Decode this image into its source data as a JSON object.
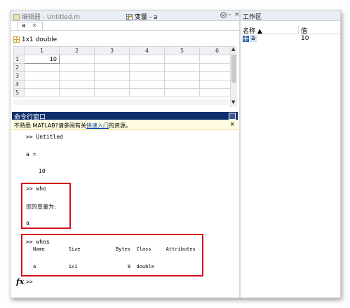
{
  "editor_tab": {
    "label": "编辑器 - Untitled.m"
  },
  "variable_tab": {
    "label": "变量 - a",
    "menu_icon": "options-icon",
    "minimize_icon": "minimize-icon",
    "close_icon": "close-icon"
  },
  "variable_subtab": {
    "label": "a",
    "close": "×"
  },
  "variable_info": {
    "label": "1x1 double"
  },
  "grid": {
    "columns": [
      "1",
      "2",
      "3",
      "4",
      "5",
      "6"
    ],
    "rows": [
      {
        "label": "1",
        "cells": [
          "10",
          "",
          "",
          "",
          "",
          ""
        ]
      },
      {
        "label": "2",
        "cells": [
          "",
          "",
          "",
          "",
          "",
          ""
        ]
      },
      {
        "label": "3",
        "cells": [
          "",
          "",
          "",
          "",
          "",
          ""
        ]
      },
      {
        "label": "4",
        "cells": [
          "",
          "",
          "",
          "",
          "",
          ""
        ]
      },
      {
        "label": "5",
        "cells": [
          "",
          "",
          "",
          "",
          "",
          ""
        ]
      }
    ]
  },
  "command_window": {
    "title": "命令行窗口",
    "notice_prefix": "不熟悉 MATLAB?请参阅有关",
    "notice_link": "快速入门",
    "notice_suffix": "的资源。",
    "lines": {
      "l1": ">> Untitled",
      "l2": "a =",
      "l3": "10",
      "l4": ">> who",
      "l5": "您的变量为:",
      "l6": "a",
      "l7": ">> whos",
      "l8": "Name        Size            Bytes  Class     Attributes",
      "l9": "a           1x1                 8  double"
    },
    "prompt": ">>",
    "fx": "fx"
  },
  "workspace": {
    "title": "工作区",
    "col_name": "名称 ▲",
    "col_value": "值",
    "rows": [
      {
        "name": "a",
        "value": "10"
      }
    ]
  },
  "colors": {
    "highlight": "#d2141e",
    "panel_header": "#0f2f6b",
    "notice_bg": "#fffbdf"
  }
}
